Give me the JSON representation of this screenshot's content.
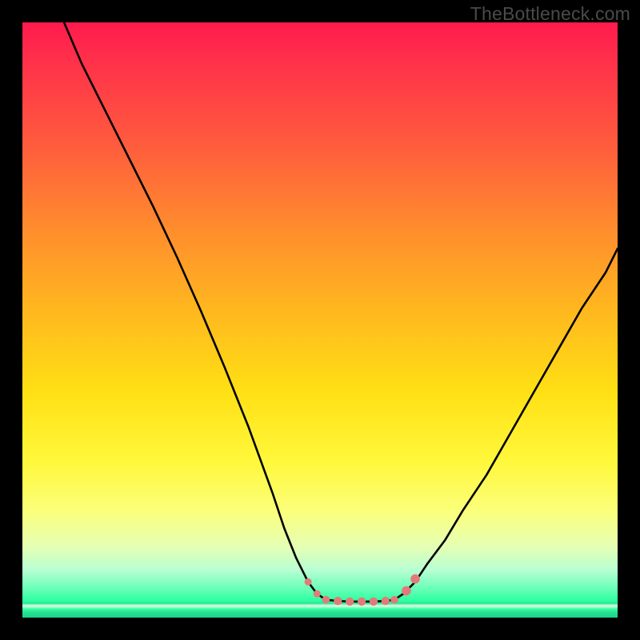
{
  "attribution": "TheBottleneck.com",
  "colors": {
    "frame": "#000000",
    "curve_stroke": "#000000",
    "marker_fill": "#e37a7a",
    "gradient_top": "#ff1a4d",
    "gradient_mid": "#ffe014",
    "gradient_bottom": "#1fd389"
  },
  "chart_data": {
    "type": "line",
    "title": "",
    "xlabel": "",
    "ylabel": "",
    "xlim": [
      0,
      100
    ],
    "ylim": [
      0,
      100
    ],
    "grid": false,
    "legend": false,
    "series": [
      {
        "name": "left-branch",
        "x": [
          7,
          10,
          14,
          18,
          22,
          26,
          30,
          34,
          38,
          42,
          44,
          46,
          48,
          49.5,
          51
        ],
        "values": [
          100,
          93,
          85,
          77,
          69,
          60.5,
          51.5,
          42,
          32,
          21,
          15,
          10,
          6,
          4,
          3
        ]
      },
      {
        "name": "flat-bottom",
        "x": [
          51,
          53,
          55,
          57,
          59,
          61,
          62.5
        ],
        "values": [
          3,
          2.8,
          2.7,
          2.7,
          2.7,
          2.8,
          3
        ]
      },
      {
        "name": "right-branch",
        "x": [
          62.5,
          64,
          66,
          68,
          71,
          74,
          78,
          82,
          86,
          90,
          94,
          98,
          100
        ],
        "values": [
          3,
          4,
          6,
          9,
          13,
          18,
          24,
          31,
          38,
          45,
          52,
          58,
          62
        ]
      }
    ],
    "markers": {
      "name": "bottom-markers",
      "x": [
        48.0,
        49.5,
        51.0,
        53.0,
        55.0,
        57.0,
        59.0,
        61.0,
        62.5,
        64.5,
        66.0
      ],
      "values": [
        6.0,
        4.0,
        3.0,
        2.8,
        2.7,
        2.7,
        2.7,
        2.8,
        3.0,
        4.5,
        6.5
      ],
      "r": [
        4.5,
        4.5,
        4.8,
        5.2,
        5.2,
        5.2,
        5.2,
        5.2,
        4.8,
        5.8,
        5.8
      ]
    }
  }
}
